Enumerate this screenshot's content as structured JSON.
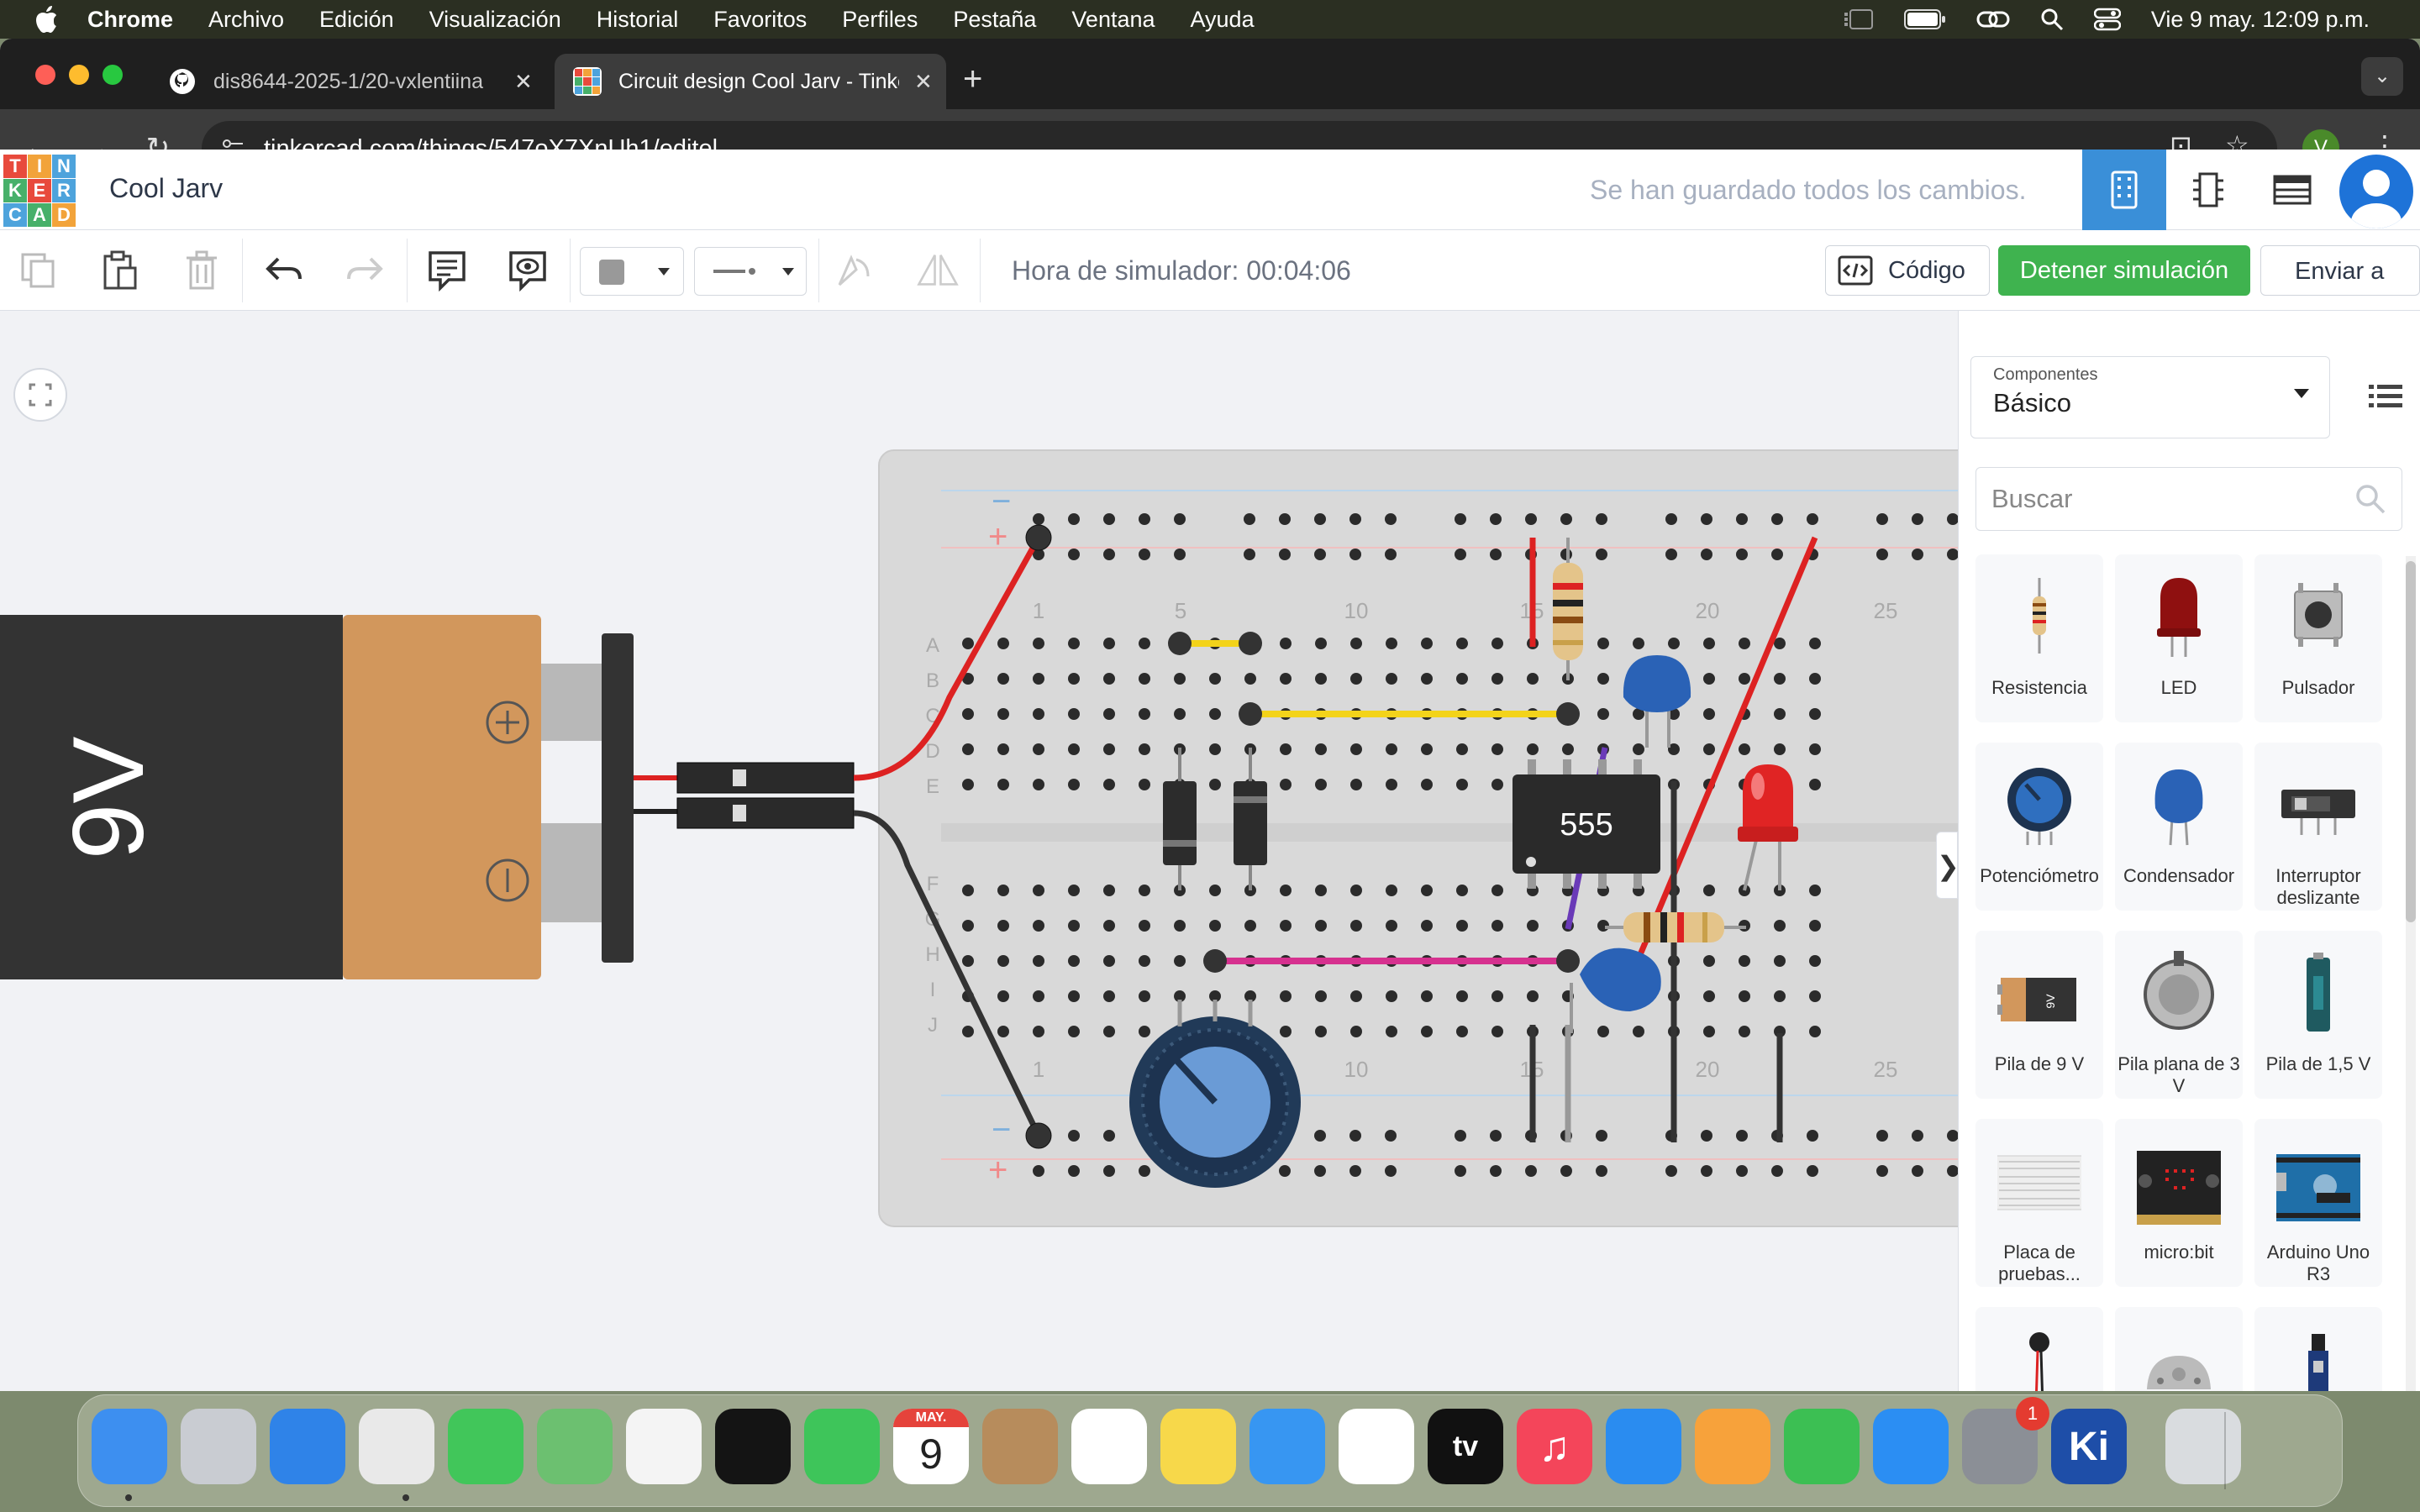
{
  "menubar": {
    "app_name": "Chrome",
    "items": [
      "Archivo",
      "Edición",
      "Visualización",
      "Historial",
      "Favoritos",
      "Perfiles",
      "Pestaña",
      "Ventana",
      "Ayuda"
    ],
    "clock": "Vie 9 may.  12:09 p.m.",
    "status_icons": [
      "stage-manager-icon",
      "battery-icon",
      "link-icon",
      "search-icon",
      "control-center-icon"
    ]
  },
  "browser": {
    "tabs": [
      {
        "title": "dis8644-2025-1/20-vxlentiina",
        "favicon": "github-icon",
        "active": false
      },
      {
        "title": "Circuit design Cool Jarv - Tinkercad",
        "favicon": "tinkercad-icon",
        "active": true
      }
    ],
    "url": "tinkercad.com/things/547oX7XnUh1/editel",
    "profile_initial": "V"
  },
  "tinkercad": {
    "logo_letters": [
      "T",
      "I",
      "N",
      "K",
      "E",
      "R",
      "C",
      "A",
      "D"
    ],
    "design_name": "Cool Jarv",
    "save_status": "Se han guardado todos los cambios.",
    "simulator_time": "Hora de simulador: 00:04:06",
    "code_button": "Código",
    "stop_button": "Detener simulación",
    "send_button": "Enviar a",
    "accent_color": "#3a8fd8",
    "stop_color": "#3fb34f"
  },
  "circuit": {
    "battery_label": "9V",
    "ic_label": "555",
    "breadboard_column_numbers": [
      "1",
      "5",
      "10",
      "15",
      "20",
      "25"
    ],
    "breadboard_row_letters_top": [
      "A",
      "B",
      "C",
      "D",
      "E"
    ],
    "breadboard_row_letters_bottom": [
      "F",
      "G",
      "H",
      "I",
      "J"
    ],
    "rail_minus": "−",
    "rail_plus": "+"
  },
  "panel": {
    "library_caption": "Componentes",
    "library_value": "Básico",
    "search_placeholder": "Buscar",
    "components": [
      {
        "label": "Resistencia",
        "icon": "resistor-icon"
      },
      {
        "label": "LED",
        "icon": "led-icon"
      },
      {
        "label": "Pulsador",
        "icon": "pushbutton-icon"
      },
      {
        "label": "Potenciómetro",
        "icon": "potentiometer-icon"
      },
      {
        "label": "Condensador",
        "icon": "capacitor-icon"
      },
      {
        "label": "Interruptor deslizante",
        "icon": "slide-switch-icon"
      },
      {
        "label": "Pila de 9 V",
        "icon": "battery-9v-icon"
      },
      {
        "label": "Pila plana de 3 V",
        "icon": "coin-cell-icon"
      },
      {
        "label": "Pila de 1,5 V",
        "icon": "battery-aa-icon"
      },
      {
        "label": "Placa de pruebas...",
        "icon": "breadboard-icon"
      },
      {
        "label": "micro:bit",
        "icon": "microbit-icon"
      },
      {
        "label": "Arduino Uno R3",
        "icon": "arduino-icon"
      },
      {
        "label": "",
        "icon": "vibration-motor-icon"
      },
      {
        "label": "",
        "icon": "dc-motor-icon"
      },
      {
        "label": "",
        "icon": "servo-icon"
      }
    ]
  },
  "dock": {
    "apps": [
      {
        "name": "finder-icon",
        "color": "#3d8ff0",
        "text": ""
      },
      {
        "name": "launchpad-icon",
        "color": "#c9ccd2",
        "text": ""
      },
      {
        "name": "safari-icon",
        "color": "#2f83e8",
        "text": ""
      },
      {
        "name": "chrome-icon",
        "color": "#e9e9e9",
        "text": ""
      },
      {
        "name": "messages-icon",
        "color": "#41c65a",
        "text": ""
      },
      {
        "name": "maps-icon",
        "color": "#6cc070",
        "text": ""
      },
      {
        "name": "photos-icon",
        "color": "#f4f4f4",
        "text": ""
      },
      {
        "name": "spotify-icon",
        "color": "#141414",
        "text": ""
      },
      {
        "name": "facetime-icon",
        "color": "#3ec55a",
        "text": ""
      },
      {
        "name": "calendar-icon",
        "color": "#ffffff",
        "text": "9"
      },
      {
        "name": "contacts-icon",
        "color": "#b78c5c",
        "text": ""
      },
      {
        "name": "reminders-icon",
        "color": "#ffffff",
        "text": ""
      },
      {
        "name": "notes-icon",
        "color": "#f7d84a",
        "text": ""
      },
      {
        "name": "mail-icon",
        "color": "#3796f2",
        "text": ""
      },
      {
        "name": "freeform-icon",
        "color": "#ffffff",
        "text": ""
      },
      {
        "name": "apple-tv-icon",
        "color": "#111111",
        "text": "tv"
      },
      {
        "name": "music-icon",
        "color": "#f4455a",
        "text": "♫"
      },
      {
        "name": "keynote-icon",
        "color": "#2a8cf0",
        "text": ""
      },
      {
        "name": "pages-icon",
        "color": "#f7a23b",
        "text": ""
      },
      {
        "name": "numbers-icon",
        "color": "#3cbf53",
        "text": ""
      },
      {
        "name": "app-store-icon",
        "color": "#2b8ef3",
        "text": ""
      },
      {
        "name": "system-settings-icon",
        "color": "#8b8f96",
        "text": ""
      },
      {
        "name": "kicad-icon",
        "color": "#1e4ea8",
        "text": "Ki"
      },
      {
        "name": "trash-icon",
        "color": "#d9dcdf",
        "text": ""
      }
    ],
    "calendar_month": "MAY.",
    "settings_badge": "1"
  }
}
